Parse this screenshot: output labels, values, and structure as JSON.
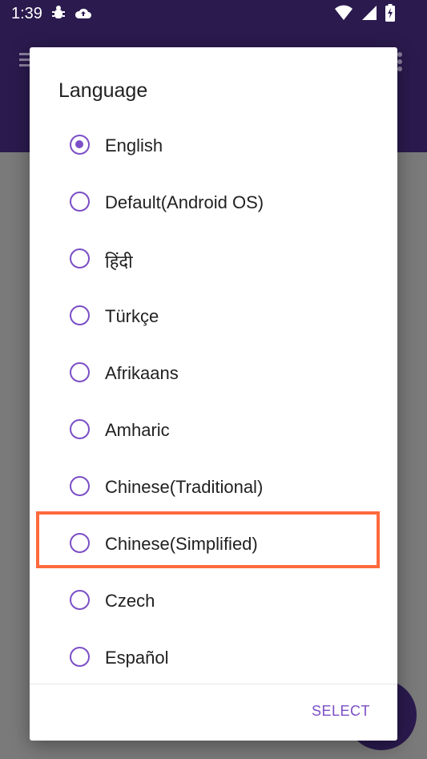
{
  "status_bar": {
    "time": "1:39",
    "left_icons": [
      "bug-notification-icon",
      "cloud-upload-icon"
    ],
    "right_icons": [
      "wifi-icon",
      "signal-icon",
      "battery-charging-icon"
    ]
  },
  "app_bar": {
    "menu_icon": "menu-icon",
    "more_icon": "more-vert-icon"
  },
  "dialog": {
    "title": "Language",
    "options": [
      {
        "label": "English",
        "selected": true
      },
      {
        "label": "Default(Android OS)",
        "selected": false
      },
      {
        "label": "हिंदी",
        "selected": false
      },
      {
        "label": "Türkçe",
        "selected": false
      },
      {
        "label": "Afrikaans",
        "selected": false
      },
      {
        "label": "Amharic",
        "selected": false
      },
      {
        "label": "Chinese(Traditional)",
        "selected": false
      },
      {
        "label": "Chinese(Simplified)",
        "selected": false
      },
      {
        "label": "Czech",
        "selected": false
      },
      {
        "label": "Español",
        "selected": false
      }
    ],
    "select_button": "SELECT"
  },
  "highlight": {
    "target": "Chinese(Simplified)",
    "color": "#ff6a3d"
  },
  "colors": {
    "app_bar": "#2a1a4e",
    "accent": "#7b4fc6",
    "scrim_bg": "#7a7a7a"
  }
}
